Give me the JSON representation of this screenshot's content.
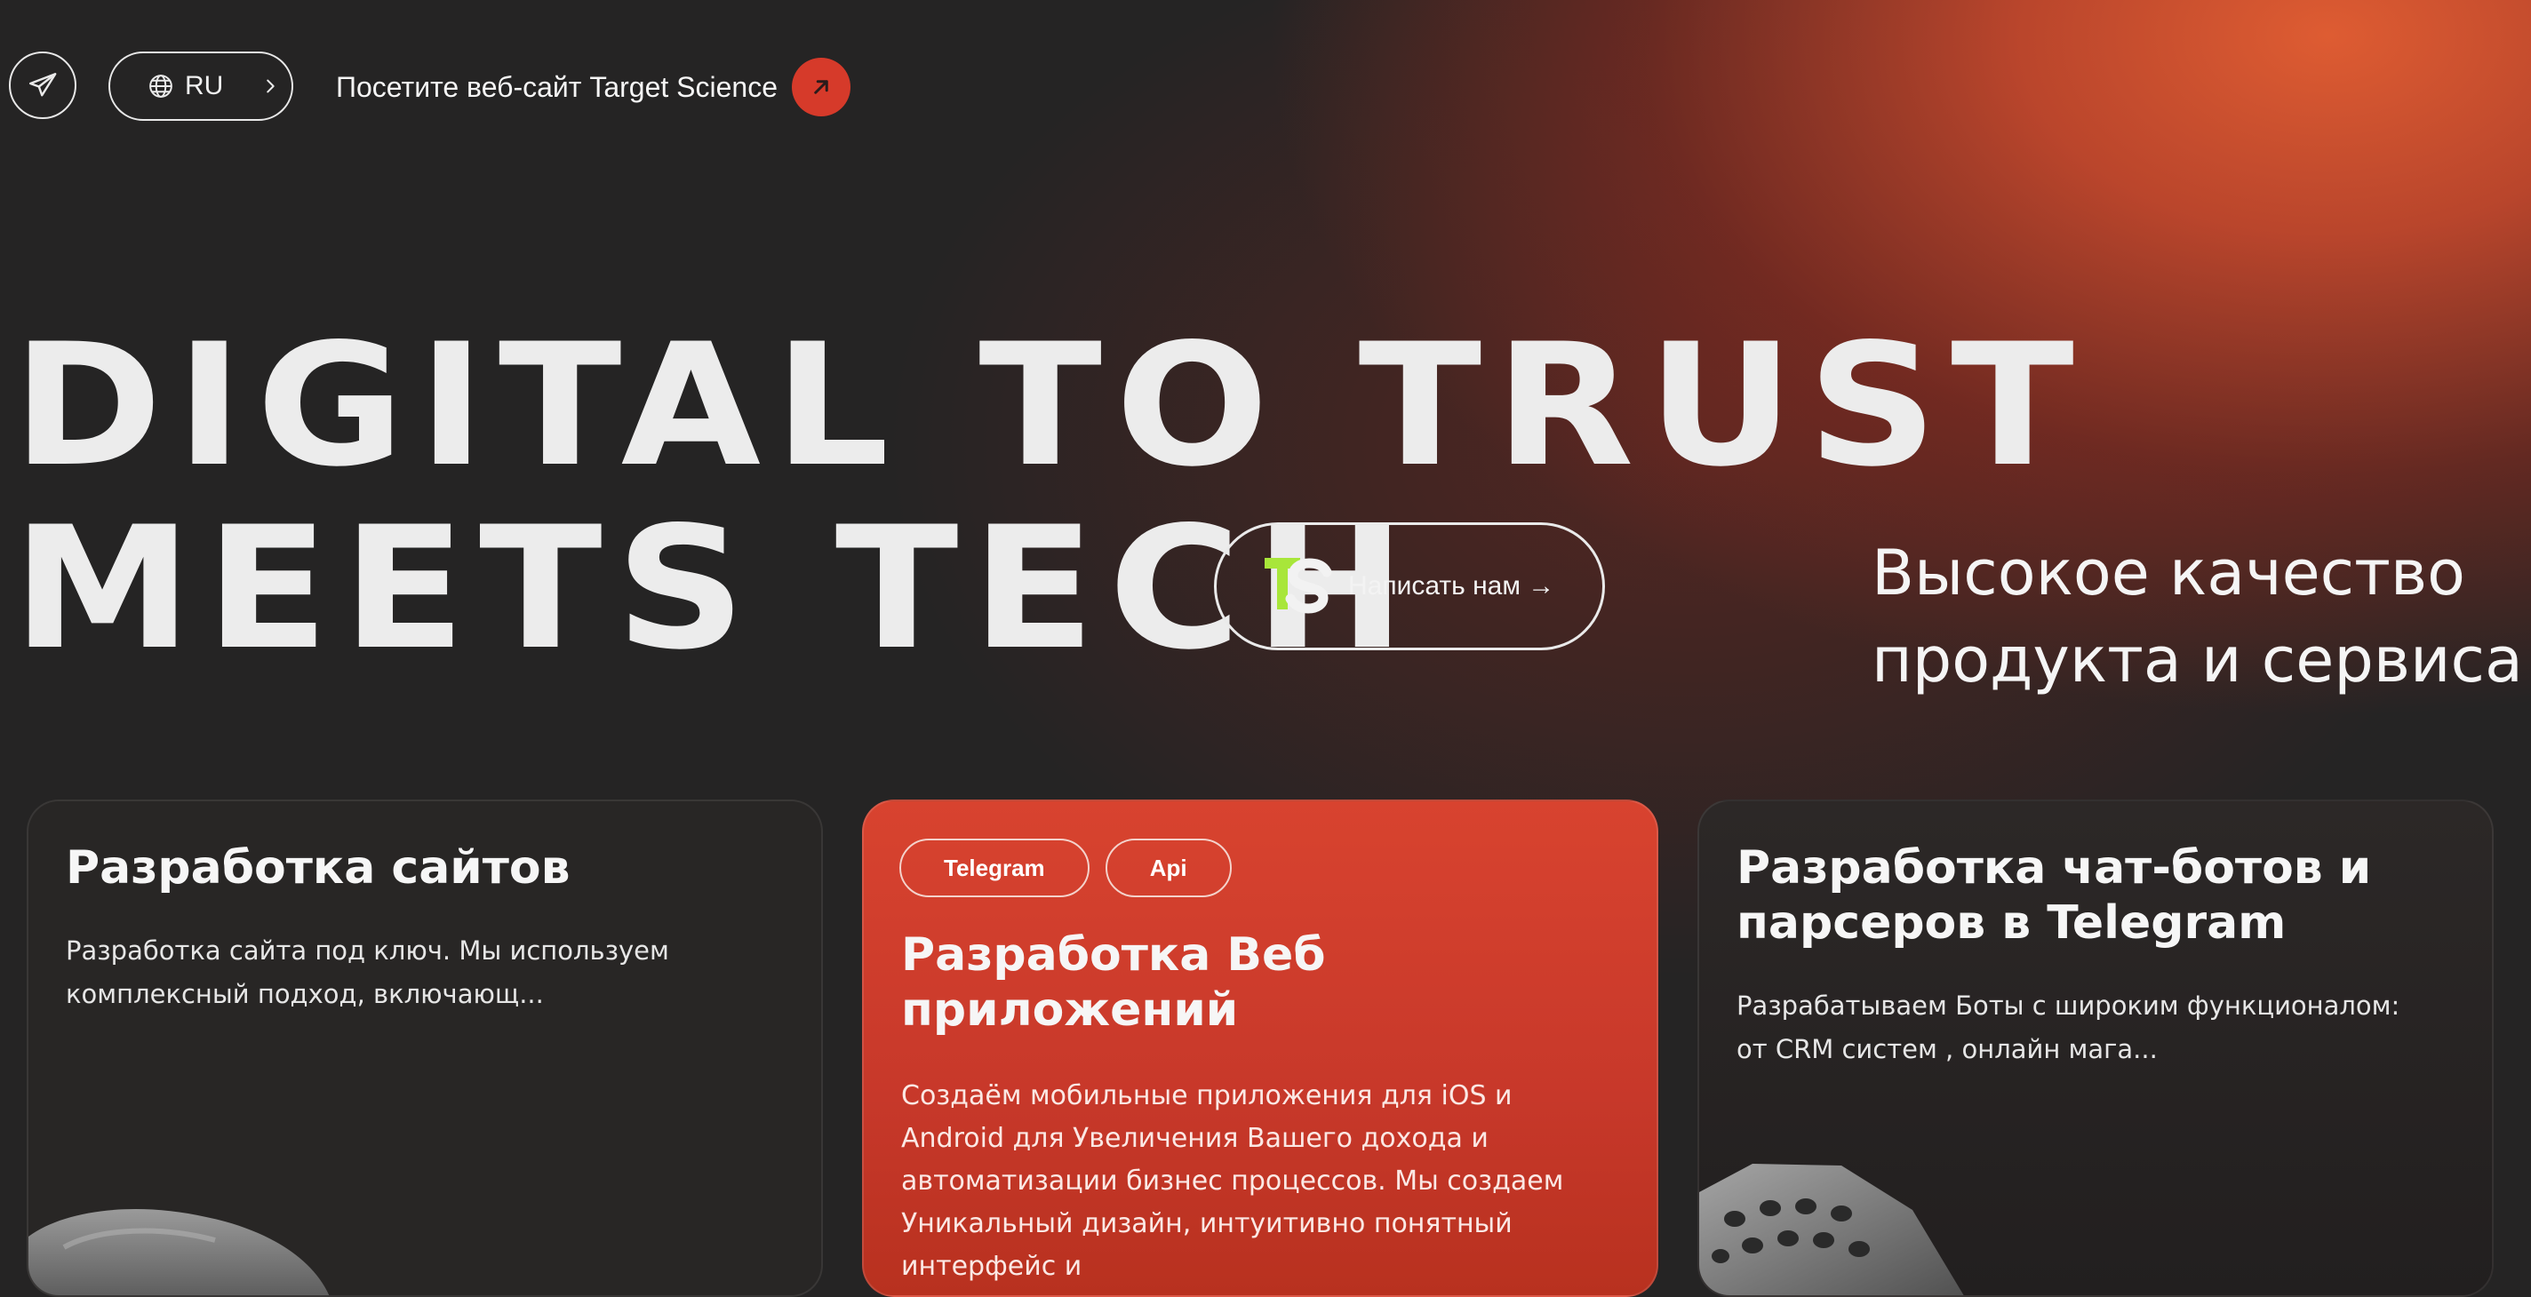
{
  "topbar": {
    "telegram_icon": "telegram-plane-icon",
    "language": {
      "code": "RU",
      "globe_icon": "globe-icon",
      "chevron_icon": "chevron-right-icon"
    },
    "visit_link": {
      "label": "Посетите веб-сайт Target Science",
      "icon": "arrow-up-right-icon"
    }
  },
  "hero": {
    "line1": "DIGITAL TO TRUST",
    "line2": "MEETS TECH",
    "contact_button": {
      "label": "Написать нам →",
      "logo": "ts-logo"
    },
    "tagline_line1": "Высокое качество",
    "tagline_line2": "продукта и сервиса"
  },
  "colors": {
    "background": "#252424",
    "accent": "#d63a2a",
    "logo_green": "#a8e63a",
    "text": "#f2f2f2"
  },
  "cards": [
    {
      "title": "Разработка сайтов",
      "description": "Разработка сайта под ключ. Мы используем комплексный подход, включающ...",
      "tags": []
    },
    {
      "title": "Разработка Веб приложений",
      "description": "Создаём мобильные приложения для iOS и Android для Увеличения Вашего дохода и автоматизации бизнес процессов. Мы создаем Уникальный дизайн, интуитивно понятный интерфейс и",
      "tags": [
        "Telegram",
        "Api"
      ]
    },
    {
      "title": "Разработка чат-ботов и парсеров в Telegram",
      "description": "Разрабатываем Боты с широким функционалом: от CRM систем , онлайн мага...",
      "tags": []
    }
  ]
}
